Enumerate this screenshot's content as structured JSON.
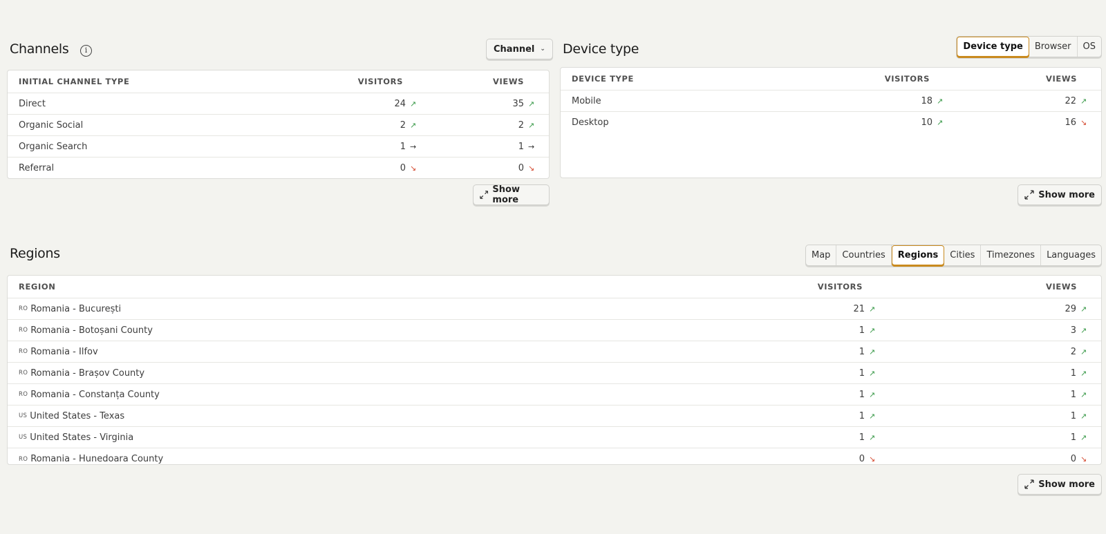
{
  "channels": {
    "title": "Channels",
    "info_icon": "info-icon",
    "dropdown_label": "Channel",
    "columns": [
      "INITIAL CHANNEL TYPE",
      "VISITORS",
      "VIEWS"
    ],
    "rows": [
      {
        "name": "Direct",
        "visitors": "24",
        "visitors_trend": "up",
        "views": "35",
        "views_trend": "up"
      },
      {
        "name": "Organic Social",
        "visitors": "2",
        "visitors_trend": "up",
        "views": "2",
        "views_trend": "up"
      },
      {
        "name": "Organic Search",
        "visitors": "1",
        "visitors_trend": "flat",
        "views": "1",
        "views_trend": "flat"
      },
      {
        "name": "Referral",
        "visitors": "0",
        "visitors_trend": "down",
        "views": "0",
        "views_trend": "down"
      }
    ],
    "show_more": "Show more"
  },
  "devices": {
    "title": "Device type",
    "tabs": [
      {
        "label": "Device type",
        "active": true
      },
      {
        "label": "Browser",
        "active": false
      },
      {
        "label": "OS",
        "active": false
      }
    ],
    "columns": [
      "DEVICE TYPE",
      "VISITORS",
      "VIEWS"
    ],
    "rows": [
      {
        "name": "Mobile",
        "visitors": "18",
        "visitors_trend": "up",
        "views": "22",
        "views_trend": "up"
      },
      {
        "name": "Desktop",
        "visitors": "10",
        "visitors_trend": "up",
        "views": "16",
        "views_trend": "down"
      }
    ],
    "show_more": "Show more"
  },
  "regions": {
    "title": "Regions",
    "tabs": [
      {
        "label": "Map",
        "active": false
      },
      {
        "label": "Countries",
        "active": false
      },
      {
        "label": "Regions",
        "active": true
      },
      {
        "label": "Cities",
        "active": false
      },
      {
        "label": "Timezones",
        "active": false
      },
      {
        "label": "Languages",
        "active": false
      }
    ],
    "columns": [
      "REGION",
      "VISITORS",
      "VIEWS"
    ],
    "rows": [
      {
        "cc": "RO",
        "name": "Romania - București",
        "visitors": "21",
        "visitors_trend": "up",
        "views": "29",
        "views_trend": "up"
      },
      {
        "cc": "RO",
        "name": "Romania - Botoșani County",
        "visitors": "1",
        "visitors_trend": "up",
        "views": "3",
        "views_trend": "up"
      },
      {
        "cc": "RO",
        "name": "Romania - Ilfov",
        "visitors": "1",
        "visitors_trend": "up",
        "views": "2",
        "views_trend": "up"
      },
      {
        "cc": "RO",
        "name": "Romania - Brașov County",
        "visitors": "1",
        "visitors_trend": "up",
        "views": "1",
        "views_trend": "up"
      },
      {
        "cc": "RO",
        "name": "Romania - Constanța County",
        "visitors": "1",
        "visitors_trend": "up",
        "views": "1",
        "views_trend": "up"
      },
      {
        "cc": "US",
        "name": "United States - Texas",
        "visitors": "1",
        "visitors_trend": "up",
        "views": "1",
        "views_trend": "up"
      },
      {
        "cc": "US",
        "name": "United States - Virginia",
        "visitors": "1",
        "visitors_trend": "up",
        "views": "1",
        "views_trend": "up"
      },
      {
        "cc": "RO",
        "name": "Romania - Hunedoara County",
        "visitors": "0",
        "visitors_trend": "down",
        "views": "0",
        "views_trend": "down"
      }
    ],
    "show_more": "Show more"
  },
  "trend_glyphs": {
    "up": "↗",
    "down": "↘",
    "flat": "→"
  },
  "colors": {
    "accent": "#c98a1e",
    "trend_up": "#3b9a4a",
    "trend_down": "#d4482e"
  }
}
